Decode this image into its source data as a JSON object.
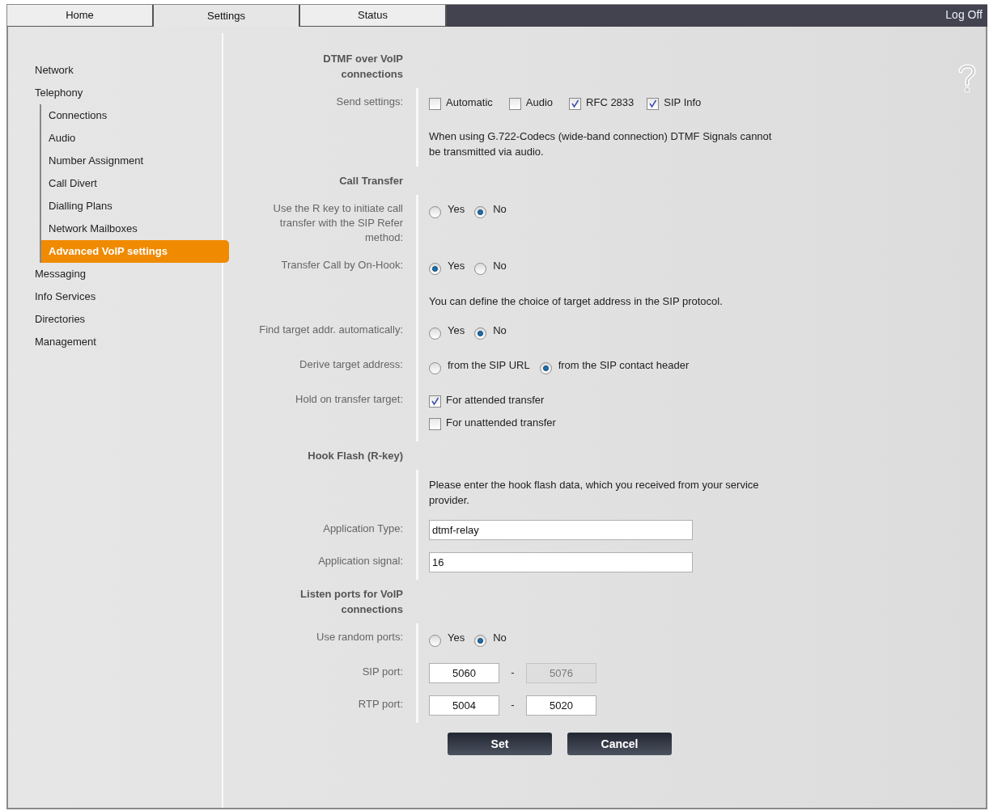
{
  "tabs": [
    {
      "label": "Home",
      "selected": false
    },
    {
      "label": "Settings",
      "selected": true
    },
    {
      "label": "Status",
      "selected": false
    }
  ],
  "log_off": "Log Off",
  "sidebar": {
    "items": [
      {
        "label": "Network",
        "selected": false
      },
      {
        "label": "Telephony",
        "selected": false,
        "children": [
          {
            "label": "Connections",
            "selected": false
          },
          {
            "label": "Audio",
            "selected": false
          },
          {
            "label": "Number Assignment",
            "selected": false
          },
          {
            "label": "Call Divert",
            "selected": false
          },
          {
            "label": "Dialling Plans",
            "selected": false
          },
          {
            "label": "Network Mailboxes",
            "selected": false
          },
          {
            "label": "Advanced VoIP settings",
            "selected": true
          }
        ]
      },
      {
        "label": "Messaging",
        "selected": false
      },
      {
        "label": "Info Services",
        "selected": false
      },
      {
        "label": "Directories",
        "selected": false
      },
      {
        "label": "Management",
        "selected": false
      }
    ]
  },
  "sections": [
    {
      "title": "DTMF over VoIP connections",
      "rows": [
        {
          "kind": "checkboxes",
          "label": "Send settings:",
          "options": [
            {
              "label": "Automatic",
              "checked": false
            },
            {
              "label": "Audio",
              "checked": false
            },
            {
              "label": "RFC 2833",
              "checked": true
            },
            {
              "label": "SIP Info",
              "checked": true
            }
          ]
        },
        {
          "kind": "note",
          "text": "When using G.722-Codecs (wide-band connection) DTMF Signals cannot be transmitted via audio."
        }
      ]
    },
    {
      "title": "Call Transfer",
      "rows": [
        {
          "kind": "radios",
          "label": "Use the R key to initiate call transfer with the SIP Refer method:",
          "options": [
            {
              "label": "Yes",
              "selected": false
            },
            {
              "label": "No",
              "selected": true
            }
          ]
        },
        {
          "kind": "radios",
          "label": "Transfer Call by On-Hook:",
          "options": [
            {
              "label": "Yes",
              "selected": true
            },
            {
              "label": "No",
              "selected": false
            }
          ]
        },
        {
          "kind": "note",
          "text": "You can define the choice of target address in the SIP protocol."
        },
        {
          "kind": "radios",
          "label": "Find target addr. automatically:",
          "options": [
            {
              "label": "Yes",
              "selected": false
            },
            {
              "label": "No",
              "selected": true
            }
          ]
        },
        {
          "kind": "radios",
          "label": "Derive target address:",
          "options": [
            {
              "label": "from the SIP URL",
              "selected": false
            },
            {
              "label": "from the SIP contact header",
              "selected": true
            }
          ]
        },
        {
          "kind": "checklist",
          "label": "Hold on transfer target:",
          "options": [
            {
              "label": "For attended transfer",
              "checked": true
            },
            {
              "label": "For unattended transfer",
              "checked": false
            }
          ]
        }
      ]
    },
    {
      "title": "Hook Flash (R-key)",
      "rows": [
        {
          "kind": "note",
          "text": "Please enter the hook flash data, which you received from your service provider."
        },
        {
          "kind": "text",
          "label": "Application Type:",
          "value": "dtmf-relay"
        },
        {
          "kind": "text",
          "label": "Application signal:",
          "value": "16"
        }
      ]
    },
    {
      "title": "Listen ports for VoIP connections",
      "rows": [
        {
          "kind": "radios",
          "label": "Use random ports:",
          "options": [
            {
              "label": "Yes",
              "selected": false
            },
            {
              "label": "No",
              "selected": true
            }
          ]
        },
        {
          "kind": "range",
          "label": "SIP port:",
          "from": {
            "value": "5060",
            "disabled": false
          },
          "separator": "-",
          "to": {
            "value": "5076",
            "disabled": true
          }
        },
        {
          "kind": "range",
          "label": "RTP port:",
          "from": {
            "value": "5004",
            "disabled": false
          },
          "separator": "-",
          "to": {
            "value": "5020",
            "disabled": false
          }
        }
      ]
    }
  ],
  "buttons": [
    "Set",
    "Cancel"
  ]
}
